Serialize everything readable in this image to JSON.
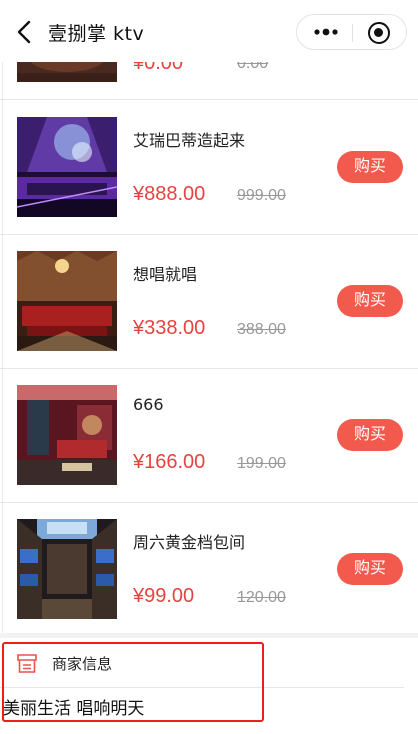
{
  "nav": {
    "title": "壹捌掌 ktv"
  },
  "partial_item": {
    "price": "¥0.00",
    "original": "0.00"
  },
  "products": [
    {
      "name": "艾瑞巴蒂造起来",
      "price": "¥888.00",
      "original": "999.00",
      "buy": "购买"
    },
    {
      "name": "想唱就唱",
      "price": "¥338.00",
      "original": "388.00",
      "buy": "购买"
    },
    {
      "name": "666",
      "price": "¥166.00",
      "original": "199.00",
      "buy": "购买"
    },
    {
      "name": "周六黄金档包间",
      "price": "¥99.00",
      "original": "120.00",
      "buy": "购买"
    }
  ],
  "merchant": {
    "title": "商家信息",
    "description": "美丽生活 唱响明天"
  },
  "colors": {
    "price": "#e64340",
    "buy_button": "#f35a4e",
    "highlight": "#e8211c"
  }
}
